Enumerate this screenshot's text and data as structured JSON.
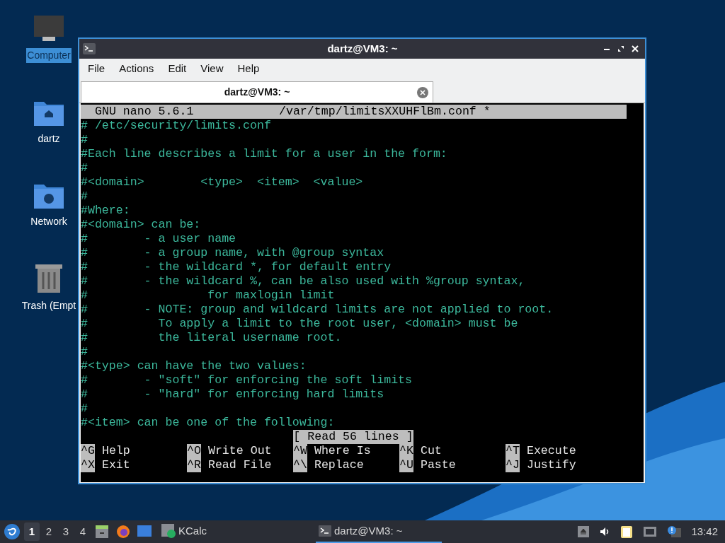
{
  "desktop_icons": [
    {
      "label": "Computer",
      "kind": "computer",
      "selected": true
    },
    {
      "label": "dartz",
      "kind": "home",
      "selected": false
    },
    {
      "label": "Network",
      "kind": "network",
      "selected": false
    },
    {
      "label": "Trash (Empt",
      "kind": "trash",
      "selected": false
    }
  ],
  "window": {
    "title": "dartz@VM3: ~",
    "menu": [
      "File",
      "Actions",
      "Edit",
      "View",
      "Help"
    ],
    "tabs": [
      {
        "label": "dartz@VM3: ~",
        "selected": true
      }
    ]
  },
  "nano": {
    "program": "GNU nano 5.6.1",
    "file": "/var/tmp/limitsXXUHFlBm.conf *",
    "lines": [
      "# /etc/security/limits.conf",
      "#",
      "#Each line describes a limit for a user in the form:",
      "#",
      "#<domain>        <type>  <item>  <value>",
      "#",
      "#Where:",
      "#<domain> can be:",
      "#        - a user name",
      "#        - a group name, with @group syntax",
      "#        - the wildcard *, for default entry",
      "#        - the wildcard %, can be also used with %group syntax,",
      "#                 for maxlogin limit",
      "#        - NOTE: group and wildcard limits are not applied to root.",
      "#          To apply a limit to the root user, <domain> must be",
      "#          the literal username root.",
      "#",
      "#<type> can have the two values:",
      "#        - \"soft\" for enforcing the soft limits",
      "#        - \"hard\" for enforcing hard limits",
      "#",
      "#<item> can be one of the following:"
    ],
    "status": "[ Read 56 lines ]",
    "shortcuts": [
      [
        {
          "key": "^G",
          "label": "Help"
        },
        {
          "key": "^O",
          "label": "Write Out"
        },
        {
          "key": "^W",
          "label": "Where Is"
        },
        {
          "key": "^K",
          "label": "Cut"
        },
        {
          "key": "^T",
          "label": "Execute"
        }
      ],
      [
        {
          "key": "^X",
          "label": "Exit"
        },
        {
          "key": "^R",
          "label": "Read File"
        },
        {
          "key": "^\\",
          "label": "Replace"
        },
        {
          "key": "^U",
          "label": "Paste"
        },
        {
          "key": "^J",
          "label": "Justify"
        }
      ]
    ]
  },
  "taskbar": {
    "workspaces": [
      {
        "label": "1",
        "selected": true
      },
      {
        "label": "2",
        "selected": false
      },
      {
        "label": "3",
        "selected": false
      },
      {
        "label": "4",
        "selected": false
      }
    ],
    "tasks": [
      {
        "label": "KCalc",
        "kind": "calc",
        "selected": false
      },
      {
        "label": "dartz@VM3: ~",
        "kind": "terminal",
        "selected": true
      }
    ],
    "clock": "13:42"
  }
}
